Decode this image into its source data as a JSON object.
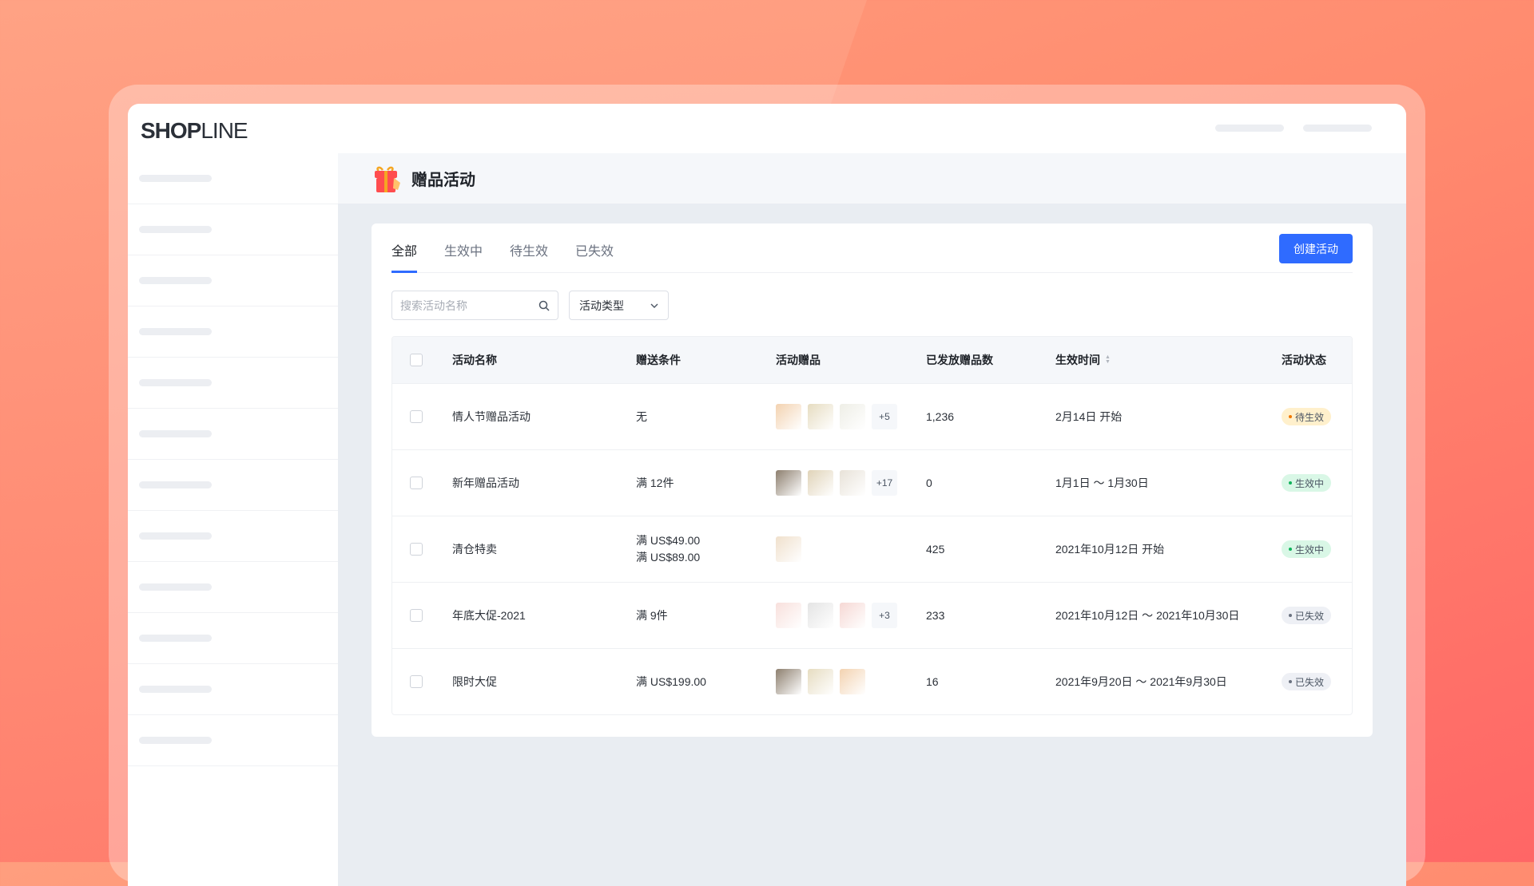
{
  "brand": {
    "logo_text_bold": "SHOP",
    "logo_text_light": "LINE"
  },
  "header": {
    "title": "赠品活动",
    "icon": "gift-icon"
  },
  "tabs": [
    {
      "label": "全部",
      "active": true
    },
    {
      "label": "生效中"
    },
    {
      "label": "待生效"
    },
    {
      "label": "已失效"
    }
  ],
  "create_button": "创建活动",
  "search": {
    "placeholder": "搜索活动名称",
    "value": ""
  },
  "filter": {
    "selected": "活动类型"
  },
  "table": {
    "columns": [
      "活动名称",
      "赠送条件",
      "活动赠品",
      "已发放赠品数",
      "生效时间",
      "活动状态"
    ],
    "rows": [
      {
        "name": "情人节赠品活动",
        "condition": [
          "无"
        ],
        "thumbs": [
          "#f3d2b0",
          "#e6dcc0",
          "#eeeee6"
        ],
        "more": "+5",
        "count": "1,236",
        "time": "2月14日 开始",
        "status": "待生效",
        "status_type": "pending"
      },
      {
        "name": "新年赠品活动",
        "condition": [
          "满 12件"
        ],
        "thumbs": [
          "#8d7f6e",
          "#e0d3b8",
          "#e8e2d8"
        ],
        "more": "+17",
        "count": "0",
        "time": "1月1日 ～ 1月30日",
        "status": "生效中",
        "status_type": "active"
      },
      {
        "name": "清仓特卖",
        "condition": [
          "满 US$49.00",
          "满 US$89.00"
        ],
        "thumbs": [
          "#f0e0cc"
        ],
        "more": "",
        "count": "425",
        "time": "2021年10月12日 开始",
        "status": "生效中",
        "status_type": "active"
      },
      {
        "name": "年底大促-2021",
        "condition": [
          "满 9件"
        ],
        "thumbs": [
          "#f8e0dc",
          "#e4e4e4",
          "#f6d8d4"
        ],
        "more": "+3",
        "count": "233",
        "time": "2021年10月12日 ～ 2021年10月30日",
        "status": "已失效",
        "status_type": "expired"
      },
      {
        "name": "限时大促",
        "condition": [
          "满 US$199.00"
        ],
        "thumbs": [
          "#8d7f6e",
          "#e6dcc0",
          "#f3d2b0"
        ],
        "more": "",
        "count": "16",
        "time": "2021年9月20日 ～ 2021年9月30日",
        "status": "已失效",
        "status_type": "expired"
      }
    ]
  },
  "colors": {
    "accent": "#2f6bff",
    "pending_bg": "#fff0cc",
    "pending_fg": "#f07800",
    "active_bg": "#d9f7e6",
    "active_fg": "#10b35b",
    "expired_bg": "#eef0f5",
    "expired_fg": "#6b7280"
  }
}
